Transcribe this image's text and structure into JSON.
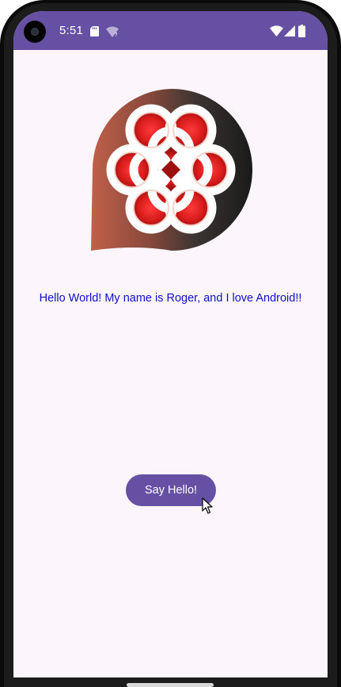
{
  "status_bar": {
    "time": "5:51",
    "background_color": "#6650a4",
    "icons": [
      "sd-card-icon",
      "wifi-question-icon",
      "wifi-icon",
      "cell-signal-icon",
      "battery-icon"
    ]
  },
  "main": {
    "logo_icon": "knot-logo-icon",
    "greeting": "Hello World! My name is Roger, and I love Android!!",
    "greeting_color": "#0f0fc8",
    "button_label": "Say Hello!"
  },
  "colors": {
    "accent": "#6650a4",
    "screen_background": "#fcf6fc"
  }
}
